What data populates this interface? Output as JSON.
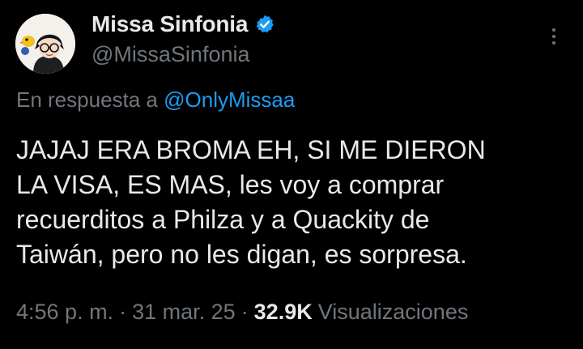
{
  "author": {
    "display_name": "Missa Sinfonia",
    "handle": "@MissaSinfonia",
    "verified": true,
    "verified_color": "#1d9bf0"
  },
  "reply": {
    "prefix": "En respuesta a",
    "mention": "@OnlyMissaa"
  },
  "tweet": {
    "lines": [
      "JAJAJ ERA BROMA EH, SI ME DIERON",
      "LA VISA, ES MAS, les voy a comprar",
      "recuerditos a Philza y a Quackity de",
      "Taiwán, pero no les digan, es sorpresa."
    ]
  },
  "meta": {
    "time": "4:56 p. m.",
    "separator": "·",
    "date": "31 mar. 25",
    "views_count": "32.9K",
    "views_label": "Visualizaciones"
  },
  "icons": {
    "avatar": "avatar-cartoon",
    "verified": "verified-badge-icon",
    "more": "more-options-icon"
  },
  "colors": {
    "background": "#000000",
    "text_primary": "#e7e9ea",
    "text_secondary": "#71767b",
    "link": "#1d9bf0"
  }
}
